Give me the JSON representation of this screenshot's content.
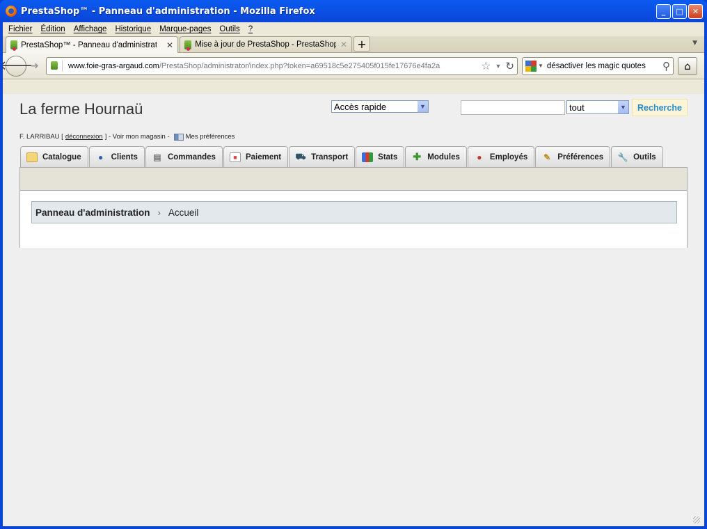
{
  "window": {
    "title": "PrestaShop™ - Panneau d'administration - Mozilla Firefox",
    "controls": {
      "minimize": "_",
      "maximize": "□",
      "close": "✕"
    }
  },
  "menu": [
    "Fichier",
    "Édition",
    "Affichage",
    "Historique",
    "Marque-pages",
    "Outils",
    "?"
  ],
  "browser_tabs": [
    {
      "label": "PrestaShop™ - Panneau d'administration",
      "close": "✕",
      "active": true
    },
    {
      "label": "Mise à jour de PrestaShop - PrestaShop ...",
      "close": "✕",
      "active": false
    }
  ],
  "new_tab": "+",
  "nav": {
    "url_host": "www.foie-gras-argaud.com",
    "url_path": "/PrestaShop/administrator/index.php?token=a69518c5e275405f015fe17676e4fa2a",
    "search_value": "désactiver les magic quotes"
  },
  "admin": {
    "shop_name": "La ferme Hournaü",
    "quick_access": "Accès rapide",
    "search_scope": "tout",
    "search_button": "Recherche",
    "user_name": "F. LARRIBAU [",
    "logout": "déconnexion",
    "user_after": "] - Voir mon magasin -",
    "my_prefs": "Mes préférences",
    "tabs": [
      {
        "label": "Catalogue",
        "icon": "folder-icon"
      },
      {
        "label": "Clients",
        "icon": "user-icon"
      },
      {
        "label": "Commandes",
        "icon": "cart-icon"
      },
      {
        "label": "Paiement",
        "icon": "invoice-icon"
      },
      {
        "label": "Transport",
        "icon": "truck-icon"
      },
      {
        "label": "Stats",
        "icon": "bar-chart-icon"
      },
      {
        "label": "Modules",
        "icon": "puzzle-icon"
      },
      {
        "label": "Employés",
        "icon": "employee-icon"
      },
      {
        "label": "Préférences",
        "icon": "edit-icon"
      },
      {
        "label": "Outils",
        "icon": "wrench-icon"
      }
    ],
    "breadcrumb": {
      "root": "Panneau d'administration",
      "separator": "›",
      "current": "Accueil"
    }
  }
}
